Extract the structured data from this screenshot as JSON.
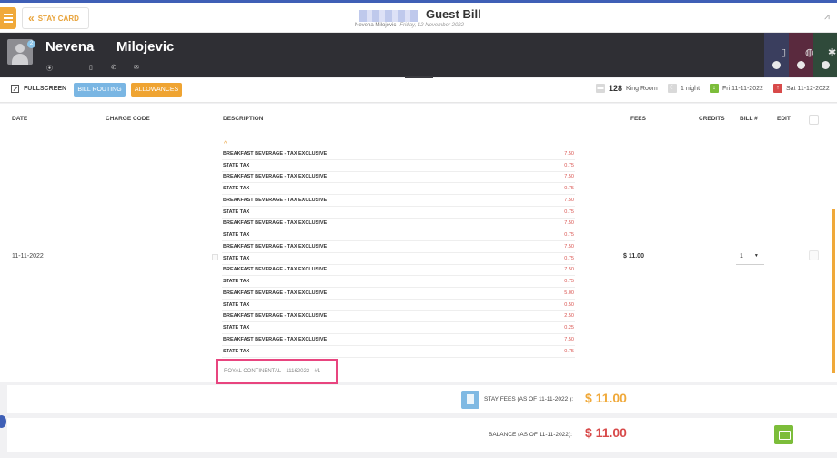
{
  "header": {
    "stay_card_label": "STAY CARD",
    "title": "Guest Bill",
    "guest_name": "Nevena Milojevic",
    "date": "Friday, 12 November 2022"
  },
  "guest": {
    "first_name": "Nevena",
    "last_name": "Milojevic",
    "badge_count": "2"
  },
  "toolbar": {
    "fullscreen_label": "FULLSCREEN",
    "bill_routing_label": "BILL ROUTING",
    "allowances_label": "ALLOWANCES",
    "room_number": "128",
    "room_type": "King Room",
    "nights": "1 night",
    "arrival": "Fri 11-11-2022",
    "departure": "Sat 11-12-2022"
  },
  "table": {
    "headers": {
      "date": "DATE",
      "charge_code": "CHARGE CODE",
      "description": "DESCRIPTION",
      "fees": "FEES",
      "credits": "CREDITS",
      "bill": "BILL #",
      "edit": "EDIT"
    },
    "row": {
      "date": "11-11-2022",
      "fees": "$ 11.00",
      "bill_number": "1",
      "lines": [
        {
          "desc": "BREAKFAST BEVERAGE - TAX EXCLUSIVE",
          "amount": "7.50"
        },
        {
          "desc": "STATE TAX",
          "amount": "0.75"
        },
        {
          "desc": "BREAKFAST BEVERAGE - TAX EXCLUSIVE",
          "amount": "7.50"
        },
        {
          "desc": "STATE TAX",
          "amount": "0.75"
        },
        {
          "desc": "BREAKFAST BEVERAGE - TAX EXCLUSIVE",
          "amount": "7.50"
        },
        {
          "desc": "STATE TAX",
          "amount": "0.75"
        },
        {
          "desc": "BREAKFAST BEVERAGE - TAX EXCLUSIVE",
          "amount": "7.50"
        },
        {
          "desc": "STATE TAX",
          "amount": "0.75"
        },
        {
          "desc": "BREAKFAST BEVERAGE - TAX EXCLUSIVE",
          "amount": "7.50"
        },
        {
          "desc": "STATE TAX",
          "amount": "0.75"
        },
        {
          "desc": "BREAKFAST BEVERAGE - TAX EXCLUSIVE",
          "amount": "7.50"
        },
        {
          "desc": "STATE TAX",
          "amount": "0.75"
        },
        {
          "desc": "BREAKFAST BEVERAGE - TAX EXCLUSIVE",
          "amount": "5.00"
        },
        {
          "desc": "STATE TAX",
          "amount": "0.50"
        },
        {
          "desc": "BREAKFAST BEVERAGE - TAX EXCLUSIVE",
          "amount": "2.50"
        },
        {
          "desc": "STATE TAX",
          "amount": "0.25"
        },
        {
          "desc": "BREAKFAST BEVERAGE - TAX EXCLUSIVE",
          "amount": "7.50"
        },
        {
          "desc": "STATE TAX",
          "amount": "0.75"
        }
      ],
      "reference": "ROYAL CONTINENTAL - 11162022 - #1"
    }
  },
  "summary": {
    "stay_fees_label": "STAY FEES (AS OF 11-11-2022 ):",
    "stay_fees_amount": "$ 11.00",
    "balance_label": "BALANCE (AS OF 11-11-2022):",
    "balance_amount": "$ 11.00"
  },
  "colors": {
    "accent_orange": "#f0a93a",
    "routing_blue": "#7ab6e3",
    "balance_red": "#d84a4a",
    "pay_green": "#7cbd3a",
    "highlight_pink": "#e8457f"
  }
}
